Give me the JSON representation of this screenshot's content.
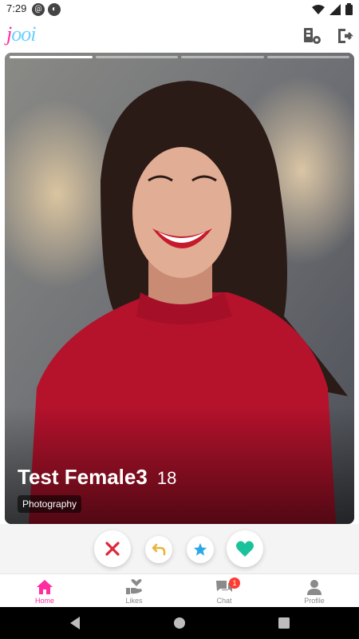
{
  "status_bar": {
    "time": "7:29",
    "icons": [
      "at-icon",
      "cast-icon"
    ],
    "right_icons": [
      "wifi-icon",
      "signal-icon",
      "battery-icon"
    ]
  },
  "app_bar": {
    "logo_text_pre": "j",
    "logo_text_o": "ooi",
    "right_icons": [
      "filter-settings-icon",
      "logout-icon"
    ]
  },
  "profile": {
    "name": "Test Female3",
    "age": "18",
    "interest_tag": "Photography",
    "photo_segments": 4,
    "active_segment": 0
  },
  "actions": {
    "items": [
      "dislike-icon",
      "rewind-icon",
      "superlike-icon",
      "like-icon"
    ],
    "colors": {
      "dislike": "#e0273a",
      "rewind": "#e7b53a",
      "superlike": "#2ba6e6",
      "like": "#19c29a"
    }
  },
  "bottom_nav": {
    "items": [
      {
        "label": "Home"
      },
      {
        "label": "Likes"
      },
      {
        "label": "Chat",
        "badge": "1"
      },
      {
        "label": "Profile"
      }
    ],
    "active_color": "#ff2da0",
    "inactive_color": "#8a8a8a"
  },
  "system_nav": {
    "items": [
      "back-icon",
      "home-icon",
      "recents-icon"
    ]
  }
}
